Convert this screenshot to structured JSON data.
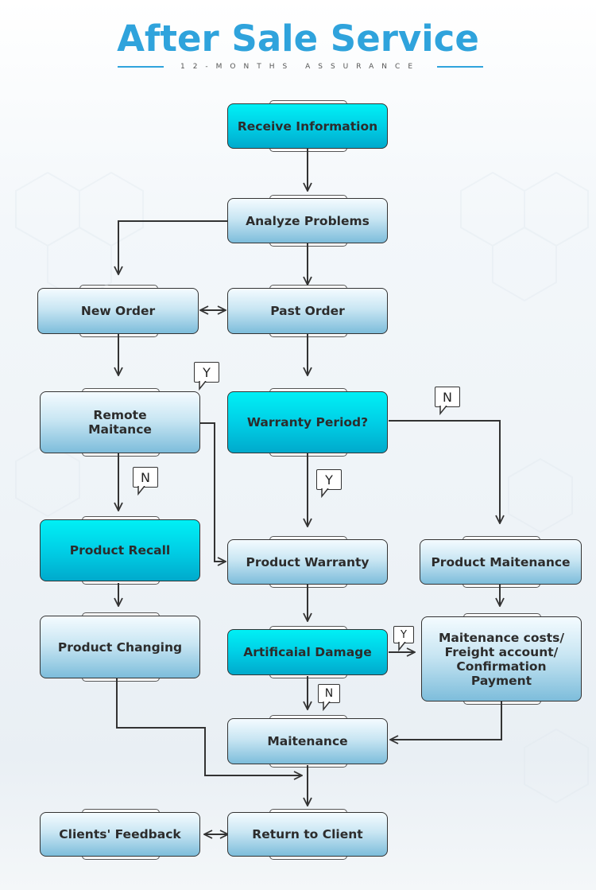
{
  "header": {
    "title": "After Sale Service",
    "subtitle": "12-MONTHS ASSURANCE"
  },
  "colors": {
    "title": "#2fa3dc",
    "highlight_node": "#00d2e8",
    "normal_node": "#9fd0e6",
    "line": "#333333"
  },
  "nodes": {
    "receive_information": "Receive Information",
    "analyze_problems": "Analyze Problems",
    "new_order": "New Order",
    "past_order": "Past Order",
    "remote_maitance": "Remote\nMaitance",
    "warranty_period": "Warranty Period?",
    "product_recall": "Product Recall",
    "product_warranty": "Product Warranty",
    "product_maitenance": "Product Maitenance",
    "product_changing": "Product Changing",
    "artificaial_damage": "Artificaial Damage",
    "maitenance_costs": "Maitenance costs/\nFreight account/\nConfirmation\nPayment",
    "maitenance": "Maitenance",
    "clients_feedback": "Clients' Feedback",
    "return_to_client": "Return to Client"
  },
  "labels": {
    "remote_yes": "Y",
    "remote_no": "N",
    "warranty_yes": "Y",
    "warranty_no": "N",
    "damage_yes": "Y",
    "damage_no": "N"
  }
}
